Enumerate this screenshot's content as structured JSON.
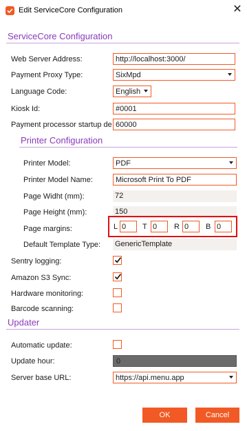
{
  "window": {
    "title": "Edit ServiceCore Configuration",
    "close_icon": "close-icon"
  },
  "sections": {
    "servicecore": "ServiceCore Configuration",
    "printer": "Printer Configuration",
    "updater": "Updater"
  },
  "fields": {
    "web_server_address": {
      "label": "Web Server Address:",
      "value": "http://localhost:3000/"
    },
    "payment_proxy_type": {
      "label": "Payment Proxy Type:",
      "value": "SixMpd"
    },
    "language_code": {
      "label": "Language Code:",
      "value": "English"
    },
    "kiosk_id": {
      "label": "Kiosk Id:",
      "value": "#0001"
    },
    "payment_processor_startup": {
      "label": "Payment processor startup del",
      "value": "60000"
    }
  },
  "printer": {
    "model": {
      "label": "Printer Model:",
      "value": "PDF"
    },
    "model_name": {
      "label": "Printer Model Name:",
      "value": "Microsoft Print To PDF"
    },
    "page_width": {
      "label": "Page Widht (mm):",
      "value": "72"
    },
    "page_height": {
      "label": "Page Height (mm):",
      "value": "150"
    },
    "page_margins": {
      "label": "Page margins:",
      "left": {
        "letter": "L",
        "value": "0"
      },
      "top": {
        "letter": "T",
        "value": "0"
      },
      "right": {
        "letter": "R",
        "value": "0"
      },
      "bottom": {
        "letter": "B",
        "value": "0"
      }
    },
    "default_template": {
      "label": "Default Template Type:",
      "value": "GenericTemplate"
    }
  },
  "toggles": {
    "sentry_logging": {
      "label": "Sentry logging:",
      "checked": true
    },
    "amazon_s3_sync": {
      "label": "Amazon S3 Sync:",
      "checked": true
    },
    "hardware_monitoring": {
      "label": "Hardware monitoring:",
      "checked": false
    },
    "barcode_scanning": {
      "label": "Barcode scanning:",
      "checked": false
    }
  },
  "updater": {
    "automatic_update": {
      "label": "Automatic update:",
      "checked": false
    },
    "update_hour": {
      "label": "Update hour:",
      "value": "0"
    },
    "server_base_url": {
      "label": "Server base URL:",
      "value": "https://api.menu.app"
    }
  },
  "buttons": {
    "ok": "OK",
    "cancel": "Cancel"
  },
  "colors": {
    "accent": "#f15a24",
    "section_header": "#8a3ab9",
    "highlight": "#e01010"
  }
}
